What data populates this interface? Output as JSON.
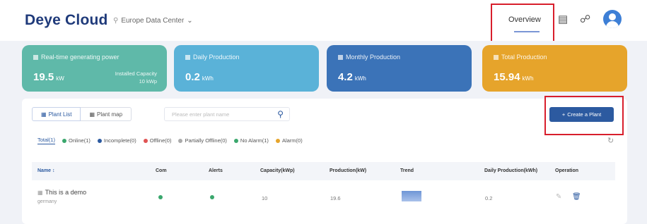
{
  "header": {
    "logo": "Deye Cloud",
    "data_center": "Europe Data Center",
    "data_center_arrow": "⌄",
    "overview_label": "Overview",
    "icons": [
      "message-icon",
      "language-icon",
      "user-avatar"
    ]
  },
  "cards": [
    {
      "title": "Real-time generating power",
      "value": "19.5",
      "unit": "kW",
      "extra_line1": "Installed Capacity",
      "extra_line2": "10 kWp",
      "color": "#5fb9a9"
    },
    {
      "title": "Daily Production",
      "value": "0.2",
      "unit": "kWh",
      "color": "#5ab2d8"
    },
    {
      "title": "Monthly Production",
      "value": "4.2",
      "unit": "kWh",
      "color": "#3b73b8"
    },
    {
      "title": "Total Production",
      "value": "15.94",
      "unit": "kWh",
      "color": "#e6a42b"
    }
  ],
  "toolbar": {
    "tab_list": "Plant List",
    "tab_map": "Plant map",
    "search_placeholder": "Please enter plant name",
    "create_button": "Create a Plant",
    "create_plus": "+"
  },
  "filters": [
    {
      "label": "Total(1)",
      "dot": ""
    },
    {
      "label": "Online(1)",
      "dot": "#3aa76d"
    },
    {
      "label": "Incomplete(0)",
      "dot": "#2c5aa0"
    },
    {
      "label": "Offline(0)",
      "dot": "#e05353"
    },
    {
      "label": "Partially Offline(0)",
      "dot": "#aaaaaa"
    },
    {
      "label": "No Alarm(1)",
      "dot": "#3aa76d"
    },
    {
      "label": "Alarm(0)",
      "dot": "#e6a42b"
    }
  ],
  "table": {
    "headers": {
      "name": "Name ↕",
      "com": "Com",
      "alerts": "Alerts",
      "capacity": "Capacity(kWp)",
      "production": "Production(kW)",
      "trend": "Trend",
      "daily": "Daily Production(kWh)",
      "operation": "Operation"
    },
    "rows": [
      {
        "name": "This is a demo",
        "location": "germany",
        "capacity": "10",
        "production": "19.6",
        "daily": "0.2"
      }
    ]
  },
  "accent_color": "#2c5aa0",
  "highlight_color": "#d81e2c"
}
